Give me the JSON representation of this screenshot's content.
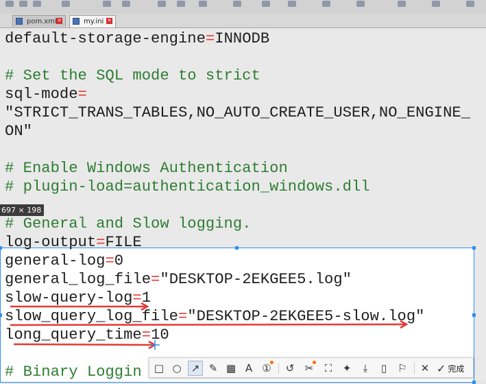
{
  "tabs": [
    {
      "label": "pom.xml",
      "active": false
    },
    {
      "label": "my.ini",
      "active": true
    }
  ],
  "editor_lines": [
    {
      "key": "line-0",
      "parts": [
        {
          "t": "default-storage-engine",
          "c": "txt"
        },
        {
          "t": "=",
          "c": "op"
        },
        {
          "t": "INNODB",
          "c": "txt"
        }
      ]
    },
    {
      "key": "line-2",
      "parts": [
        {
          "t": "# Set the SQL mode to strict",
          "c": "cmt"
        }
      ]
    },
    {
      "key": "line-3",
      "parts": [
        {
          "t": "sql-mode",
          "c": "txt"
        },
        {
          "t": "=",
          "c": "op"
        }
      ]
    },
    {
      "key": "line-4",
      "parts": [
        {
          "t": "\"STRICT_TRANS_TABLES,NO_AUTO_CREATE_USER,NO_ENGINE_",
          "c": "txt"
        }
      ]
    },
    {
      "key": "line-5",
      "parts": [
        {
          "t": "ON\"",
          "c": "txt"
        }
      ]
    },
    {
      "key": "line-7",
      "parts": [
        {
          "t": "# Enable Windows Authentication",
          "c": "cmt"
        }
      ]
    },
    {
      "key": "line-8",
      "parts": [
        {
          "t": "# plugin-load=authentication_windows.dll",
          "c": "cmt"
        }
      ]
    },
    {
      "key": "line-10",
      "parts": [
        {
          "t": "# General and Slow logging.",
          "c": "cmt"
        }
      ]
    },
    {
      "key": "line-11",
      "parts": [
        {
          "t": "log-output",
          "c": "txt"
        },
        {
          "t": "=",
          "c": "op"
        },
        {
          "t": "FILE",
          "c": "txt"
        }
      ]
    },
    {
      "key": "line-12",
      "parts": [
        {
          "t": "general-log",
          "c": "txt"
        },
        {
          "t": "=",
          "c": "op"
        },
        {
          "t": "0",
          "c": "txt"
        }
      ]
    },
    {
      "key": "line-13",
      "parts": [
        {
          "t": "general_log_file",
          "c": "txt"
        },
        {
          "t": "=",
          "c": "op"
        },
        {
          "t": "\"DESKTOP-2EKGEE5.log\"",
          "c": "txt"
        }
      ]
    },
    {
      "key": "line-14",
      "parts": [
        {
          "t": "slow-query-log",
          "c": "txt"
        },
        {
          "t": "=",
          "c": "op"
        },
        {
          "t": "1",
          "c": "txt"
        }
      ]
    },
    {
      "key": "line-15",
      "parts": [
        {
          "t": "slow_query_log_file",
          "c": "txt"
        },
        {
          "t": "=",
          "c": "op"
        },
        {
          "t": "\"DESKTOP-2EKGEE5-slow.log\"",
          "c": "txt"
        }
      ]
    },
    {
      "key": "line-16",
      "parts": [
        {
          "t": "long_query_time",
          "c": "txt"
        },
        {
          "t": "=",
          "c": "op"
        },
        {
          "t": "10",
          "c": "txt"
        }
      ]
    },
    {
      "key": "line-18",
      "parts": [
        {
          "t": "# Binary Loggin",
          "c": "cmt"
        }
      ]
    }
  ],
  "selection": {
    "dimensions": "697 × 198",
    "border_color": "#2f8ff0"
  },
  "annotation_color": "#e53935",
  "colors": {
    "comment": "#2e7d32",
    "operator": "#e53935",
    "text": "#1e1e1e"
  },
  "screenshot_toolbar": {
    "tools": [
      {
        "name": "rectangle-tool",
        "icon": "rectangle-icon"
      },
      {
        "name": "ellipse-tool",
        "icon": "ellipse-icon"
      },
      {
        "name": "arrow-tool",
        "icon": "arrow-icon",
        "active": true
      },
      {
        "name": "pen-tool",
        "icon": "pen-icon"
      },
      {
        "name": "mosaic-tool",
        "icon": "mosaic-icon"
      },
      {
        "name": "text-tool",
        "icon": "text-icon"
      },
      {
        "name": "number-tool",
        "icon": "numbered-marker-icon"
      },
      {
        "name": "undo-tool",
        "icon": "undo-icon"
      },
      {
        "name": "cut-tool",
        "icon": "scissors-icon"
      },
      {
        "name": "crop-tool",
        "icon": "crop-icon"
      },
      {
        "name": "pin-tool",
        "icon": "pin-icon"
      },
      {
        "name": "download-tool",
        "icon": "download-icon"
      },
      {
        "name": "phone-tool",
        "icon": "phone-icon"
      },
      {
        "name": "bookmark-tool",
        "icon": "bookmark-icon"
      },
      {
        "name": "cancel-tool",
        "icon": "close-icon"
      }
    ],
    "done_label": "完成"
  }
}
